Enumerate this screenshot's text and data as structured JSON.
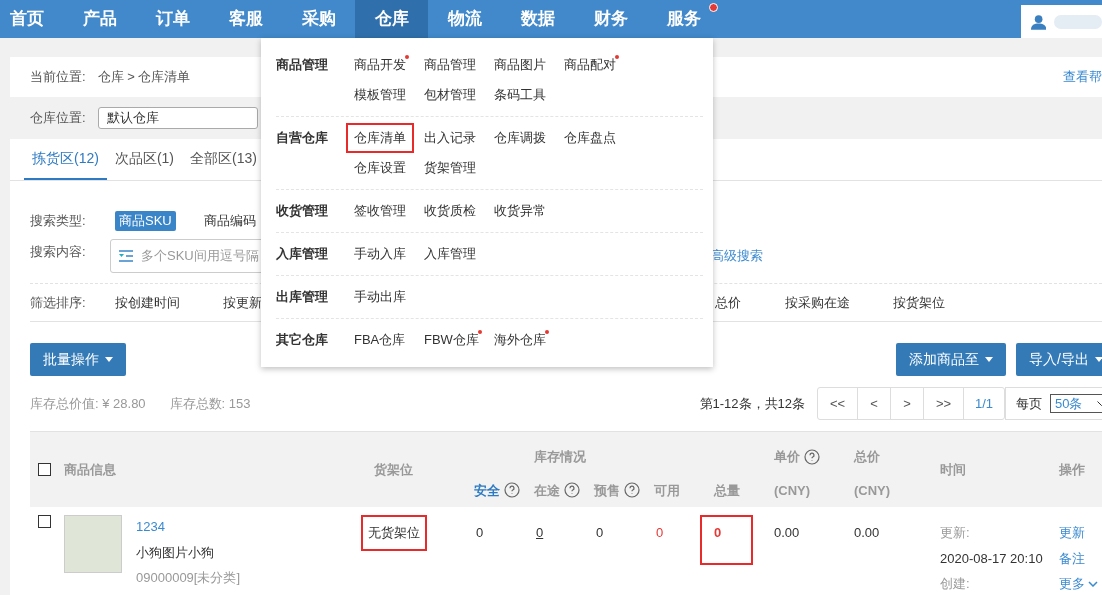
{
  "nav": {
    "items": [
      {
        "label": "首页",
        "selected": false,
        "dot": false
      },
      {
        "label": "产品",
        "selected": false,
        "dot": false
      },
      {
        "label": "订单",
        "selected": false,
        "dot": false
      },
      {
        "label": "客服",
        "selected": false,
        "dot": false
      },
      {
        "label": "采购",
        "selected": false,
        "dot": false
      },
      {
        "label": "仓库",
        "selected": true,
        "dot": false
      },
      {
        "label": "物流",
        "selected": false,
        "dot": false
      },
      {
        "label": "数据",
        "selected": false,
        "dot": false
      },
      {
        "label": "财务",
        "selected": false,
        "dot": false
      },
      {
        "label": "服务",
        "selected": false,
        "dot": true
      }
    ]
  },
  "breadcrumb": {
    "label": "当前位置:",
    "path": "仓库 > 仓库清单",
    "help": "查看帮"
  },
  "location": {
    "label": "仓库位置:",
    "value": "默认仓库"
  },
  "tabs": [
    {
      "label": "拣货区(12)",
      "selected": true
    },
    {
      "label": "次品区(1)",
      "selected": false
    },
    {
      "label": "全部区(13)",
      "selected": false
    }
  ],
  "search": {
    "type_label": "搜索类型:",
    "types": [
      {
        "label": "商品SKU",
        "selected": true
      },
      {
        "label": "商品编码",
        "selected": false
      }
    ],
    "content_label": "搜索内容:",
    "placeholder": "多个SKU间用逗号隔",
    "advanced": "高级搜索"
  },
  "sort": {
    "label": "筛选排序:",
    "items_left": [
      "按创建时间",
      "按更新"
    ],
    "items_right": [
      "总价",
      "按采购在途",
      "按货架位"
    ]
  },
  "actions": {
    "batch": "批量操作",
    "add": "添加商品至",
    "import_export": "导入/导出"
  },
  "stats": [
    "库存总价值: ¥ 28.80",
    "库存总数: 153"
  ],
  "pagination": {
    "summary": "第1-12条，共12条",
    "buttons": [
      "<<",
      "<",
      ">",
      ">>"
    ],
    "page": "1/1",
    "per_page_label": "每页",
    "per_page": "50条"
  },
  "table": {
    "header": {
      "checked": false,
      "product": "商品信息",
      "shelf": "货架位",
      "stock_group": "库存情况",
      "stock_columns": [
        {
          "label": "安全",
          "help": true,
          "selected": true
        },
        {
          "label": "在途",
          "help": true,
          "selected": false
        },
        {
          "label": "预售",
          "help": true,
          "selected": false
        },
        {
          "label": "可用",
          "help": false,
          "selected": false
        },
        {
          "label": "总量",
          "help": false,
          "selected": false
        }
      ],
      "unit_price": {
        "label": "单价",
        "unit": "(CNY)",
        "help": true
      },
      "total_price": {
        "label": "总价",
        "unit": "(CNY)",
        "help": false
      },
      "time": "时间",
      "actions": "操作"
    },
    "rows": [
      {
        "checked": false,
        "sku": "1234",
        "name": "小狗图片小狗",
        "code": "09000009[未分类]",
        "shelf": {
          "text": "无货架位",
          "highlighted": true
        },
        "stock": [
          {
            "value": "0",
            "kind": "plain",
            "highlighted": false
          },
          {
            "value": "0",
            "kind": "link",
            "highlighted": false
          },
          {
            "value": "0",
            "kind": "plain",
            "highlighted": false
          },
          {
            "value": "0",
            "kind": "alert",
            "highlighted": false
          },
          {
            "value": "0",
            "kind": "total",
            "highlighted": true
          }
        ],
        "unit_price": "0.00",
        "total_price": "0.00",
        "time": [
          {
            "label": "更新:",
            "value": "2020-08-17 20:10"
          },
          {
            "label": "创建:"
          }
        ],
        "actions": [
          {
            "label": "更新",
            "menu": false
          },
          {
            "label": "备注",
            "menu": false
          },
          {
            "label": "更多",
            "menu": true
          }
        ]
      }
    ]
  },
  "menu": {
    "groups": [
      {
        "label": "商品管理",
        "items": [
          {
            "label": "商品开发",
            "dot": true,
            "highlighted": false
          },
          {
            "label": "商品管理",
            "dot": false,
            "highlighted": false
          },
          {
            "label": "商品图片",
            "dot": false,
            "highlighted": false
          },
          {
            "label": "商品配对",
            "dot": true,
            "highlighted": false
          },
          {
            "label": "模板管理",
            "dot": false,
            "highlighted": false
          },
          {
            "label": "包材管理",
            "dot": false,
            "highlighted": false
          },
          {
            "label": "条码工具",
            "dot": false,
            "highlighted": false
          }
        ]
      },
      {
        "label": "自营仓库",
        "items": [
          {
            "label": "仓库清单",
            "dot": false,
            "highlighted": true
          },
          {
            "label": "出入记录",
            "dot": false,
            "highlighted": false
          },
          {
            "label": "仓库调拨",
            "dot": false,
            "highlighted": false
          },
          {
            "label": "仓库盘点",
            "dot": false,
            "highlighted": false
          },
          {
            "label": "仓库设置",
            "dot": false,
            "highlighted": false
          },
          {
            "label": "货架管理",
            "dot": false,
            "highlighted": false
          }
        ]
      },
      {
        "label": "收货管理",
        "items": [
          {
            "label": "签收管理",
            "dot": false,
            "highlighted": false
          },
          {
            "label": "收货质检",
            "dot": false,
            "highlighted": false
          },
          {
            "label": "收货异常",
            "dot": false,
            "highlighted": false
          }
        ]
      },
      {
        "label": "入库管理",
        "items": [
          {
            "label": "手动入库",
            "dot": false,
            "highlighted": false
          },
          {
            "label": "入库管理",
            "dot": false,
            "highlighted": false
          }
        ]
      },
      {
        "label": "出库管理",
        "items": [
          {
            "label": "手动出库",
            "dot": false,
            "highlighted": false
          }
        ]
      },
      {
        "label": "其它仓库",
        "items": [
          {
            "label": "FBA仓库",
            "dot": false,
            "highlighted": false
          },
          {
            "label": "FBW仓库",
            "dot": true,
            "highlighted": false
          },
          {
            "label": "海外仓库",
            "dot": true,
            "highlighted": false
          }
        ]
      }
    ]
  }
}
